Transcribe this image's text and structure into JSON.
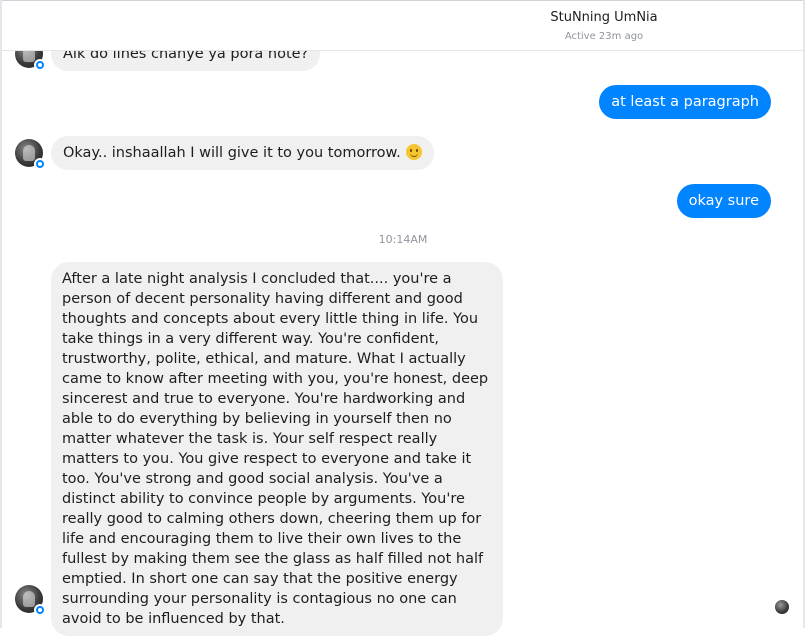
{
  "header": {
    "name": "StuNning UmNia",
    "status": "Active 23m ago"
  },
  "messages": [
    {
      "from": "them",
      "text": "Aik do lines chanye ya pora note?"
    },
    {
      "from": "me",
      "text": "at least a paragraph"
    },
    {
      "from": "them",
      "text": "Okay.. inshaallah I will give it to you tomorrow.",
      "emoji": "slightly-smiling-face"
    },
    {
      "from": "me",
      "text": "okay sure"
    },
    {
      "from": "them",
      "text": "After a late night analysis I concluded that.... you're a person of decent personality having different and good thoughts and concepts about every little thing in life. You take things in a very different way. You're confident, trustworthy, polite, ethical, and mature. What I actually came to know after meeting with you, you're honest, deep sincerest and true to everyone. You're hardworking and able to do everything by believing in yourself then no matter whatever the task is. Your self respect really matters to you. You give respect to everyone and take it too. You've strong and good social analysis. You've a distinct ability to convince people by arguments. You're really good to calming others down, cheering them up for life and encouraging them to live their own lives to the fullest by making them see the glass as half filled not half emptied. In short one can say that the positive energy surrounding your personality is contagious no one can avoid to be influenced by that."
    }
  ],
  "timestamp": "10:14AM",
  "colors": {
    "outgoing_bubble": "#0084ff",
    "incoming_bubble": "#f1f0f0",
    "meta_text": "#90949c"
  }
}
